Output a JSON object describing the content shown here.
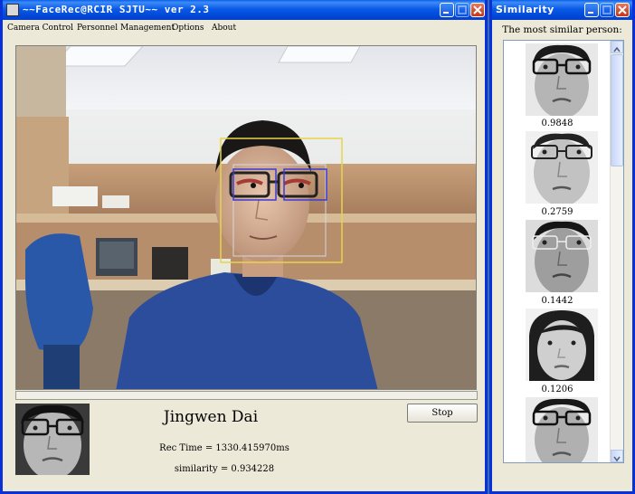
{
  "main_window": {
    "title": "~~FaceRec@RCIR SJTU~~  ver 2.3",
    "menu": [
      "Camera Control",
      "Personnel Management",
      "Options",
      "About"
    ],
    "recognized_name": "Jingwen Dai",
    "rec_time": "Rec Time = 1330.415970ms",
    "similarity": "similarity = 0.934228",
    "stop_label": "Stop",
    "progress": 0
  },
  "similarity_window": {
    "title": "Similarity",
    "heading": "The most similar person:",
    "results": [
      {
        "score": "0.9848"
      },
      {
        "score": "0.2759"
      },
      {
        "score": "0.1442"
      },
      {
        "score": "0.1206"
      },
      {
        "score": ""
      }
    ]
  },
  "colors": {
    "titlebar": "#0a5ae8",
    "window_bg": "#ece9d8",
    "face_box": "#e8d44a",
    "eye_box": "#3b3bd6",
    "desktop": "#3a6ea5"
  },
  "icons": [
    "minimize-icon",
    "maximize-icon",
    "close-icon",
    "app-icon",
    "scroll-up-icon",
    "scroll-down-icon"
  ]
}
